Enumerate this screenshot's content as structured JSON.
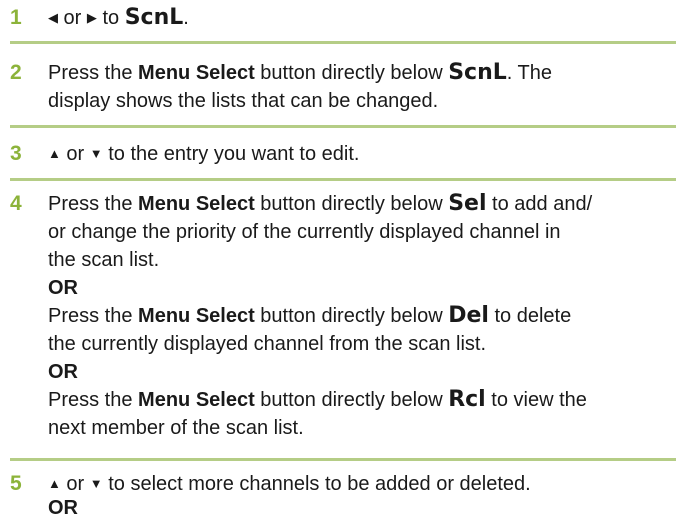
{
  "steps": [
    {
      "num": "1",
      "lines": [
        {
          "parts": [
            "",
            " or ",
            " to ",
            "ScnL",
            "."
          ]
        }
      ]
    },
    {
      "num": "2",
      "lines": [
        {
          "a": "Press the ",
          "b": "Menu Select",
          "c": " button directly below ",
          "d": "ScnL",
          "e": ". The"
        },
        {
          "text": "display shows the lists that can be changed."
        }
      ]
    },
    {
      "num": "3",
      "lines": [
        {
          "a": " or ",
          "b": " to the entry you want to edit."
        }
      ]
    },
    {
      "num": "4",
      "l1": {
        "a": "Press the ",
        "b": "Menu Select",
        "c": " button directly below ",
        "d": "Sel",
        "e": " to add and/"
      },
      "l2": "or change the priority of the currently displayed channel in",
      "l3": "the scan list.",
      "or1": "OR",
      "l5": {
        "a": "Press the ",
        "b": "Menu Select",
        "c": " button directly below ",
        "d": "Del",
        "e": " to delete"
      },
      "l6": "the currently displayed channel from the scan list.",
      "or2": "OR",
      "l8": {
        "a": "Press the ",
        "b": "Menu Select",
        "c": " button directly below ",
        "d": "Rcl",
        "e": " to view the"
      },
      "l9": "next member of the scan list."
    },
    {
      "num": "5",
      "l1": {
        "a": " or ",
        "b": " to select more channels to be added or deleted."
      },
      "or1": "OR"
    }
  ],
  "icons": {
    "left": "left-arrow-icon",
    "right": "right-arrow-icon",
    "up": "up-arrow-icon",
    "down": "down-arrow-icon"
  },
  "colors": {
    "step_number": "#8cb33a",
    "divider": "#b5cd86",
    "text": "#1a1a1a"
  }
}
